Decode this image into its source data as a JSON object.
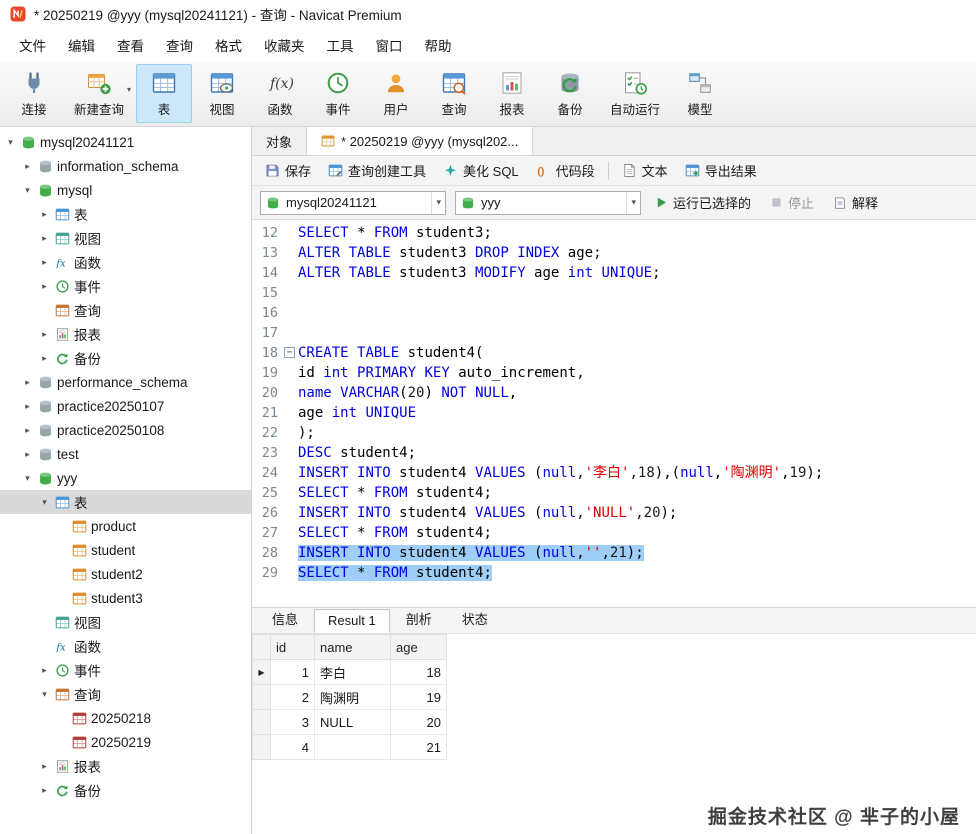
{
  "window": {
    "title": "* 20250219 @yyy (mysql20241121) - 查询 - Navicat Premium"
  },
  "menu_bar": {
    "items": [
      "文件",
      "编辑",
      "查看",
      "查询",
      "格式",
      "收藏夹",
      "工具",
      "窗口",
      "帮助"
    ]
  },
  "main_toolbar": {
    "items": [
      {
        "label": "连接",
        "icon": "connection-icon",
        "selected": false,
        "caret": false
      },
      {
        "label": "新建查询",
        "icon": "new-query-icon",
        "selected": false,
        "caret": true
      },
      {
        "label": "表",
        "icon": "tables-icon",
        "selected": true,
        "caret": false
      },
      {
        "label": "视图",
        "icon": "views-icon",
        "selected": false,
        "caret": false
      },
      {
        "label": "函数",
        "icon": "functions-icon",
        "selected": false,
        "caret": false
      },
      {
        "label": "事件",
        "icon": "events-icon",
        "selected": false,
        "caret": false
      },
      {
        "label": "用户",
        "icon": "users-icon",
        "selected": false,
        "caret": false
      },
      {
        "label": "查询",
        "icon": "queries-icon",
        "selected": false,
        "caret": false
      },
      {
        "label": "报表",
        "icon": "reports-icon",
        "selected": false,
        "caret": false
      },
      {
        "label": "备份",
        "icon": "backups-icon",
        "selected": false,
        "caret": false
      },
      {
        "label": "自动运行",
        "icon": "automation-icon",
        "selected": false,
        "caret": false
      },
      {
        "label": "模型",
        "icon": "models-icon",
        "selected": false,
        "caret": false
      }
    ]
  },
  "sidebar": {
    "tree": [
      {
        "label": "mysql20241121",
        "depth": 0,
        "arrow": "down",
        "icon": "connection-db-icon",
        "selected": false
      },
      {
        "label": "information_schema",
        "depth": 1,
        "arrow": "right",
        "icon": "database-gray-icon",
        "selected": false
      },
      {
        "label": "mysql",
        "depth": 1,
        "arrow": "down",
        "icon": "database-green-icon",
        "selected": false
      },
      {
        "label": "表",
        "depth": 2,
        "arrow": "right",
        "icon": "tables-folder-icon",
        "selected": false
      },
      {
        "label": "视图",
        "depth": 2,
        "arrow": "right",
        "icon": "views-folder-icon",
        "selected": false
      },
      {
        "label": "函数",
        "depth": 2,
        "arrow": "right",
        "icon": "fx-icon",
        "selected": false
      },
      {
        "label": "事件",
        "depth": 2,
        "arrow": "right",
        "icon": "event-icon",
        "selected": false
      },
      {
        "label": "查询",
        "depth": 2,
        "arrow": "none",
        "icon": "query-folder-icon",
        "selected": false
      },
      {
        "label": "报表",
        "depth": 2,
        "arrow": "right",
        "icon": "report-icon",
        "selected": false
      },
      {
        "label": "备份",
        "depth": 2,
        "arrow": "right",
        "icon": "backup-icon",
        "selected": false
      },
      {
        "label": "performance_schema",
        "depth": 1,
        "arrow": "right",
        "icon": "database-gray-icon",
        "selected": false
      },
      {
        "label": "practice20250107",
        "depth": 1,
        "arrow": "right",
        "icon": "database-gray-icon",
        "selected": false
      },
      {
        "label": "practice20250108",
        "depth": 1,
        "arrow": "right",
        "icon": "database-gray-icon",
        "selected": false
      },
      {
        "label": "test",
        "depth": 1,
        "arrow": "right",
        "icon": "database-gray-icon",
        "selected": false
      },
      {
        "label": "yyy",
        "depth": 1,
        "arrow": "down",
        "icon": "database-green-icon",
        "selected": false
      },
      {
        "label": "表",
        "depth": 2,
        "arrow": "down",
        "icon": "tables-folder-icon",
        "selected": true
      },
      {
        "label": "product",
        "depth": 3,
        "arrow": "none",
        "icon": "table-icon",
        "selected": false
      },
      {
        "label": "student",
        "depth": 3,
        "arrow": "none",
        "icon": "table-icon",
        "selected": false
      },
      {
        "label": "student2",
        "depth": 3,
        "arrow": "none",
        "icon": "table-icon",
        "selected": false
      },
      {
        "label": "student3",
        "depth": 3,
        "arrow": "none",
        "icon": "table-icon",
        "selected": false
      },
      {
        "label": "视图",
        "depth": 2,
        "arrow": "none",
        "icon": "views-folder-icon",
        "selected": false
      },
      {
        "label": "函数",
        "depth": 2,
        "arrow": "none",
        "icon": "fx-icon",
        "selected": false
      },
      {
        "label": "事件",
        "depth": 2,
        "arrow": "right",
        "icon": "event-icon",
        "selected": false
      },
      {
        "label": "查询",
        "depth": 2,
        "arrow": "down",
        "icon": "query-folder-icon",
        "selected": false
      },
      {
        "label": "20250218",
        "depth": 3,
        "arrow": "none",
        "icon": "query-item-icon",
        "selected": false
      },
      {
        "label": "20250219",
        "depth": 3,
        "arrow": "none",
        "icon": "query-item-icon",
        "selected": false
      },
      {
        "label": "报表",
        "depth": 2,
        "arrow": "right",
        "icon": "report-icon",
        "selected": false
      },
      {
        "label": "备份",
        "depth": 2,
        "arrow": "right",
        "icon": "backup-icon",
        "selected": false
      }
    ]
  },
  "workspace": {
    "doc_tabs": [
      {
        "label": "对象",
        "icon": null,
        "active": false
      },
      {
        "label": "* 20250219 @yyy (mysql202...",
        "icon": "table-tab-icon",
        "active": true
      }
    ],
    "query_toolbar": [
      {
        "label": "保存",
        "icon": "save-icon",
        "sep_before": false
      },
      {
        "label": "查询创建工具",
        "icon": "query-builder-icon",
        "sep_before": false
      },
      {
        "label": "美化 SQL",
        "icon": "beautify-sql-icon",
        "sep_before": false
      },
      {
        "label": "代码段",
        "icon": "code-snippet-icon",
        "sep_before": false
      },
      {
        "label": "文本",
        "icon": "text-file-icon",
        "sep_before": true
      },
      {
        "label": "导出结果",
        "icon": "export-result-icon",
        "sep_before": false
      }
    ],
    "run_bar": {
      "connection": "mysql20241121",
      "database": "yyy",
      "run_label": "运行已选择的",
      "stop_label": "停止",
      "explain_label": "解释"
    },
    "editor": {
      "lines": [
        {
          "num": 12,
          "sel": false,
          "fold": false,
          "tokens": [
            [
              "k",
              "SELECT"
            ],
            [
              "p",
              " * "
            ],
            [
              "k",
              "FROM"
            ],
            [
              "p",
              " student3;"
            ]
          ]
        },
        {
          "num": 13,
          "sel": false,
          "fold": false,
          "tokens": [
            [
              "k",
              "ALTER"
            ],
            [
              "p",
              " "
            ],
            [
              "k",
              "TABLE"
            ],
            [
              "p",
              " student3 "
            ],
            [
              "k",
              "DROP"
            ],
            [
              "p",
              " "
            ],
            [
              "k",
              "INDEX"
            ],
            [
              "p",
              " age;"
            ]
          ]
        },
        {
          "num": 14,
          "sel": false,
          "fold": false,
          "tokens": [
            [
              "k",
              "ALTER"
            ],
            [
              "p",
              " "
            ],
            [
              "k",
              "TABLE"
            ],
            [
              "p",
              " student3 "
            ],
            [
              "k",
              "MODIFY"
            ],
            [
              "p",
              " age "
            ],
            [
              "k",
              "int"
            ],
            [
              "p",
              " "
            ],
            [
              "k",
              "UNIQUE"
            ],
            [
              "p",
              ";"
            ]
          ]
        },
        {
          "num": 15,
          "sel": false,
          "fold": false,
          "tokens": []
        },
        {
          "num": 16,
          "sel": false,
          "fold": false,
          "tokens": []
        },
        {
          "num": 17,
          "sel": false,
          "fold": false,
          "tokens": []
        },
        {
          "num": 18,
          "sel": false,
          "fold": true,
          "tokens": [
            [
              "k",
              "CREATE"
            ],
            [
              "p",
              " "
            ],
            [
              "k",
              "TABLE"
            ],
            [
              "p",
              " student4("
            ]
          ]
        },
        {
          "num": 19,
          "sel": false,
          "fold": false,
          "tokens": [
            [
              "p",
              "id "
            ],
            [
              "k",
              "int"
            ],
            [
              "p",
              " "
            ],
            [
              "k",
              "PRIMARY"
            ],
            [
              "p",
              " "
            ],
            [
              "k",
              "KEY"
            ],
            [
              "p",
              " auto_increment,"
            ]
          ]
        },
        {
          "num": 20,
          "sel": false,
          "fold": false,
          "tokens": [
            [
              "k",
              "name"
            ],
            [
              "p",
              " "
            ],
            [
              "k",
              "VARCHAR"
            ],
            [
              "p",
              "("
            ],
            [
              "n",
              "20"
            ],
            [
              "p",
              ") "
            ],
            [
              "k",
              "NOT"
            ],
            [
              "p",
              " "
            ],
            [
              "k",
              "NULL"
            ],
            [
              "p",
              ","
            ]
          ]
        },
        {
          "num": 21,
          "sel": false,
          "fold": false,
          "tokens": [
            [
              "p",
              "age "
            ],
            [
              "k",
              "int"
            ],
            [
              "p",
              " "
            ],
            [
              "k",
              "UNIQUE"
            ]
          ]
        },
        {
          "num": 22,
          "sel": false,
          "fold": false,
          "tokens": [
            [
              "p",
              ");"
            ]
          ]
        },
        {
          "num": 23,
          "sel": false,
          "fold": false,
          "tokens": [
            [
              "k",
              "DESC"
            ],
            [
              "p",
              " student4;"
            ]
          ]
        },
        {
          "num": 24,
          "sel": false,
          "fold": false,
          "tokens": [
            [
              "k",
              "INSERT"
            ],
            [
              "p",
              " "
            ],
            [
              "k",
              "INTO"
            ],
            [
              "p",
              " student4 "
            ],
            [
              "k",
              "VALUES"
            ],
            [
              "p",
              " ("
            ],
            [
              "k",
              "null"
            ],
            [
              "p",
              ","
            ],
            [
              "s",
              "'李白'"
            ],
            [
              "p",
              ","
            ],
            [
              "n",
              "18"
            ],
            [
              "p",
              "),("
            ],
            [
              "k",
              "null"
            ],
            [
              "p",
              ","
            ],
            [
              "s",
              "'陶渊明'"
            ],
            [
              "p",
              ","
            ],
            [
              "n",
              "19"
            ],
            [
              "p",
              ");"
            ]
          ]
        },
        {
          "num": 25,
          "sel": false,
          "fold": false,
          "tokens": [
            [
              "k",
              "SELECT"
            ],
            [
              "p",
              " * "
            ],
            [
              "k",
              "FROM"
            ],
            [
              "p",
              " student4;"
            ]
          ]
        },
        {
          "num": 26,
          "sel": false,
          "fold": false,
          "tokens": [
            [
              "k",
              "INSERT"
            ],
            [
              "p",
              " "
            ],
            [
              "k",
              "INTO"
            ],
            [
              "p",
              " student4 "
            ],
            [
              "k",
              "VALUES"
            ],
            [
              "p",
              " ("
            ],
            [
              "k",
              "null"
            ],
            [
              "p",
              ","
            ],
            [
              "s",
              "'NULL'"
            ],
            [
              "p",
              ","
            ],
            [
              "n",
              "20"
            ],
            [
              "p",
              ");"
            ]
          ]
        },
        {
          "num": 27,
          "sel": false,
          "fold": false,
          "tokens": [
            [
              "k",
              "SELECT"
            ],
            [
              "p",
              " * "
            ],
            [
              "k",
              "FROM"
            ],
            [
              "p",
              " student4;"
            ]
          ]
        },
        {
          "num": 28,
          "sel": true,
          "fold": false,
          "tokens": [
            [
              "k",
              "INSERT"
            ],
            [
              "p",
              " "
            ],
            [
              "k",
              "INTO"
            ],
            [
              "p",
              " student4 "
            ],
            [
              "k",
              "VALUES"
            ],
            [
              "p",
              " ("
            ],
            [
              "k",
              "null"
            ],
            [
              "p",
              ","
            ],
            [
              "s",
              "''"
            ],
            [
              "p",
              ","
            ],
            [
              "n",
              "21"
            ],
            [
              "p",
              ");"
            ]
          ]
        },
        {
          "num": 29,
          "sel": true,
          "fold": false,
          "tokens": [
            [
              "k",
              "SELECT"
            ],
            [
              "p",
              " * "
            ],
            [
              "k",
              "FROM"
            ],
            [
              "p",
              " student4;"
            ]
          ]
        }
      ]
    },
    "result_tabs": [
      {
        "label": "信息",
        "active": false
      },
      {
        "label": "Result 1",
        "active": true
      },
      {
        "label": "剖析",
        "active": false
      },
      {
        "label": "状态",
        "active": false
      }
    ],
    "result_grid": {
      "columns": [
        {
          "label": "id",
          "align": "right",
          "key": "id"
        },
        {
          "label": "name",
          "align": "left",
          "key": "name"
        },
        {
          "label": "age",
          "align": "right",
          "key": "age"
        }
      ],
      "rows": [
        [
          "1",
          "李白",
          "18"
        ],
        [
          "2",
          "陶渊明",
          "19"
        ],
        [
          "3",
          "NULL",
          "20"
        ],
        [
          "4",
          "",
          "21"
        ]
      ],
      "current_row_index": 0
    }
  },
  "watermark": "掘金技术社区 @ 芈子的小屋",
  "syntax_colors": {
    "keyword": "#0000e0",
    "string": "#dd0000",
    "number": "#1a1a1a",
    "selection": "#9ecef5"
  }
}
